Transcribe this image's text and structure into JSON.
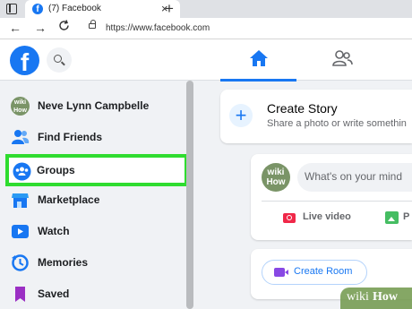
{
  "browser": {
    "tab_title": "(7) Facebook",
    "tab_favicon": "f",
    "tab_close": "×",
    "new_tab": "+",
    "back_icon": "←",
    "forward_icon": "→",
    "url": "https://www.facebook.com"
  },
  "header": {
    "logo": "f",
    "home_color": "#1877f2"
  },
  "sidebar": {
    "items": [
      {
        "label": "Neve Lynn Campbelle",
        "icon": "profile-avatar"
      },
      {
        "label": "Find Friends",
        "icon": "friends-icon"
      },
      {
        "label": "Groups",
        "icon": "groups-icon",
        "selected": true
      },
      {
        "label": "Marketplace",
        "icon": "marketplace-icon"
      },
      {
        "label": "Watch",
        "icon": "watch-icon"
      },
      {
        "label": "Memories",
        "icon": "memories-icon"
      },
      {
        "label": "Saved",
        "icon": "saved-icon"
      }
    ],
    "avatar_text": "wiki How"
  },
  "feed": {
    "story_plus": "+",
    "story_title": "Create Story",
    "story_subtitle": "Share a photo or write somethin",
    "post_avatar_text": "wiki How",
    "post_placeholder": "What's on your mind",
    "live_label": "Live video",
    "photo_label": "P",
    "room_label": "Create Room"
  },
  "watermark": {
    "part1": "wiki",
    "part2": "How"
  },
  "colors": {
    "accent": "#1877f2",
    "highlight_border": "#2fdc2f"
  }
}
